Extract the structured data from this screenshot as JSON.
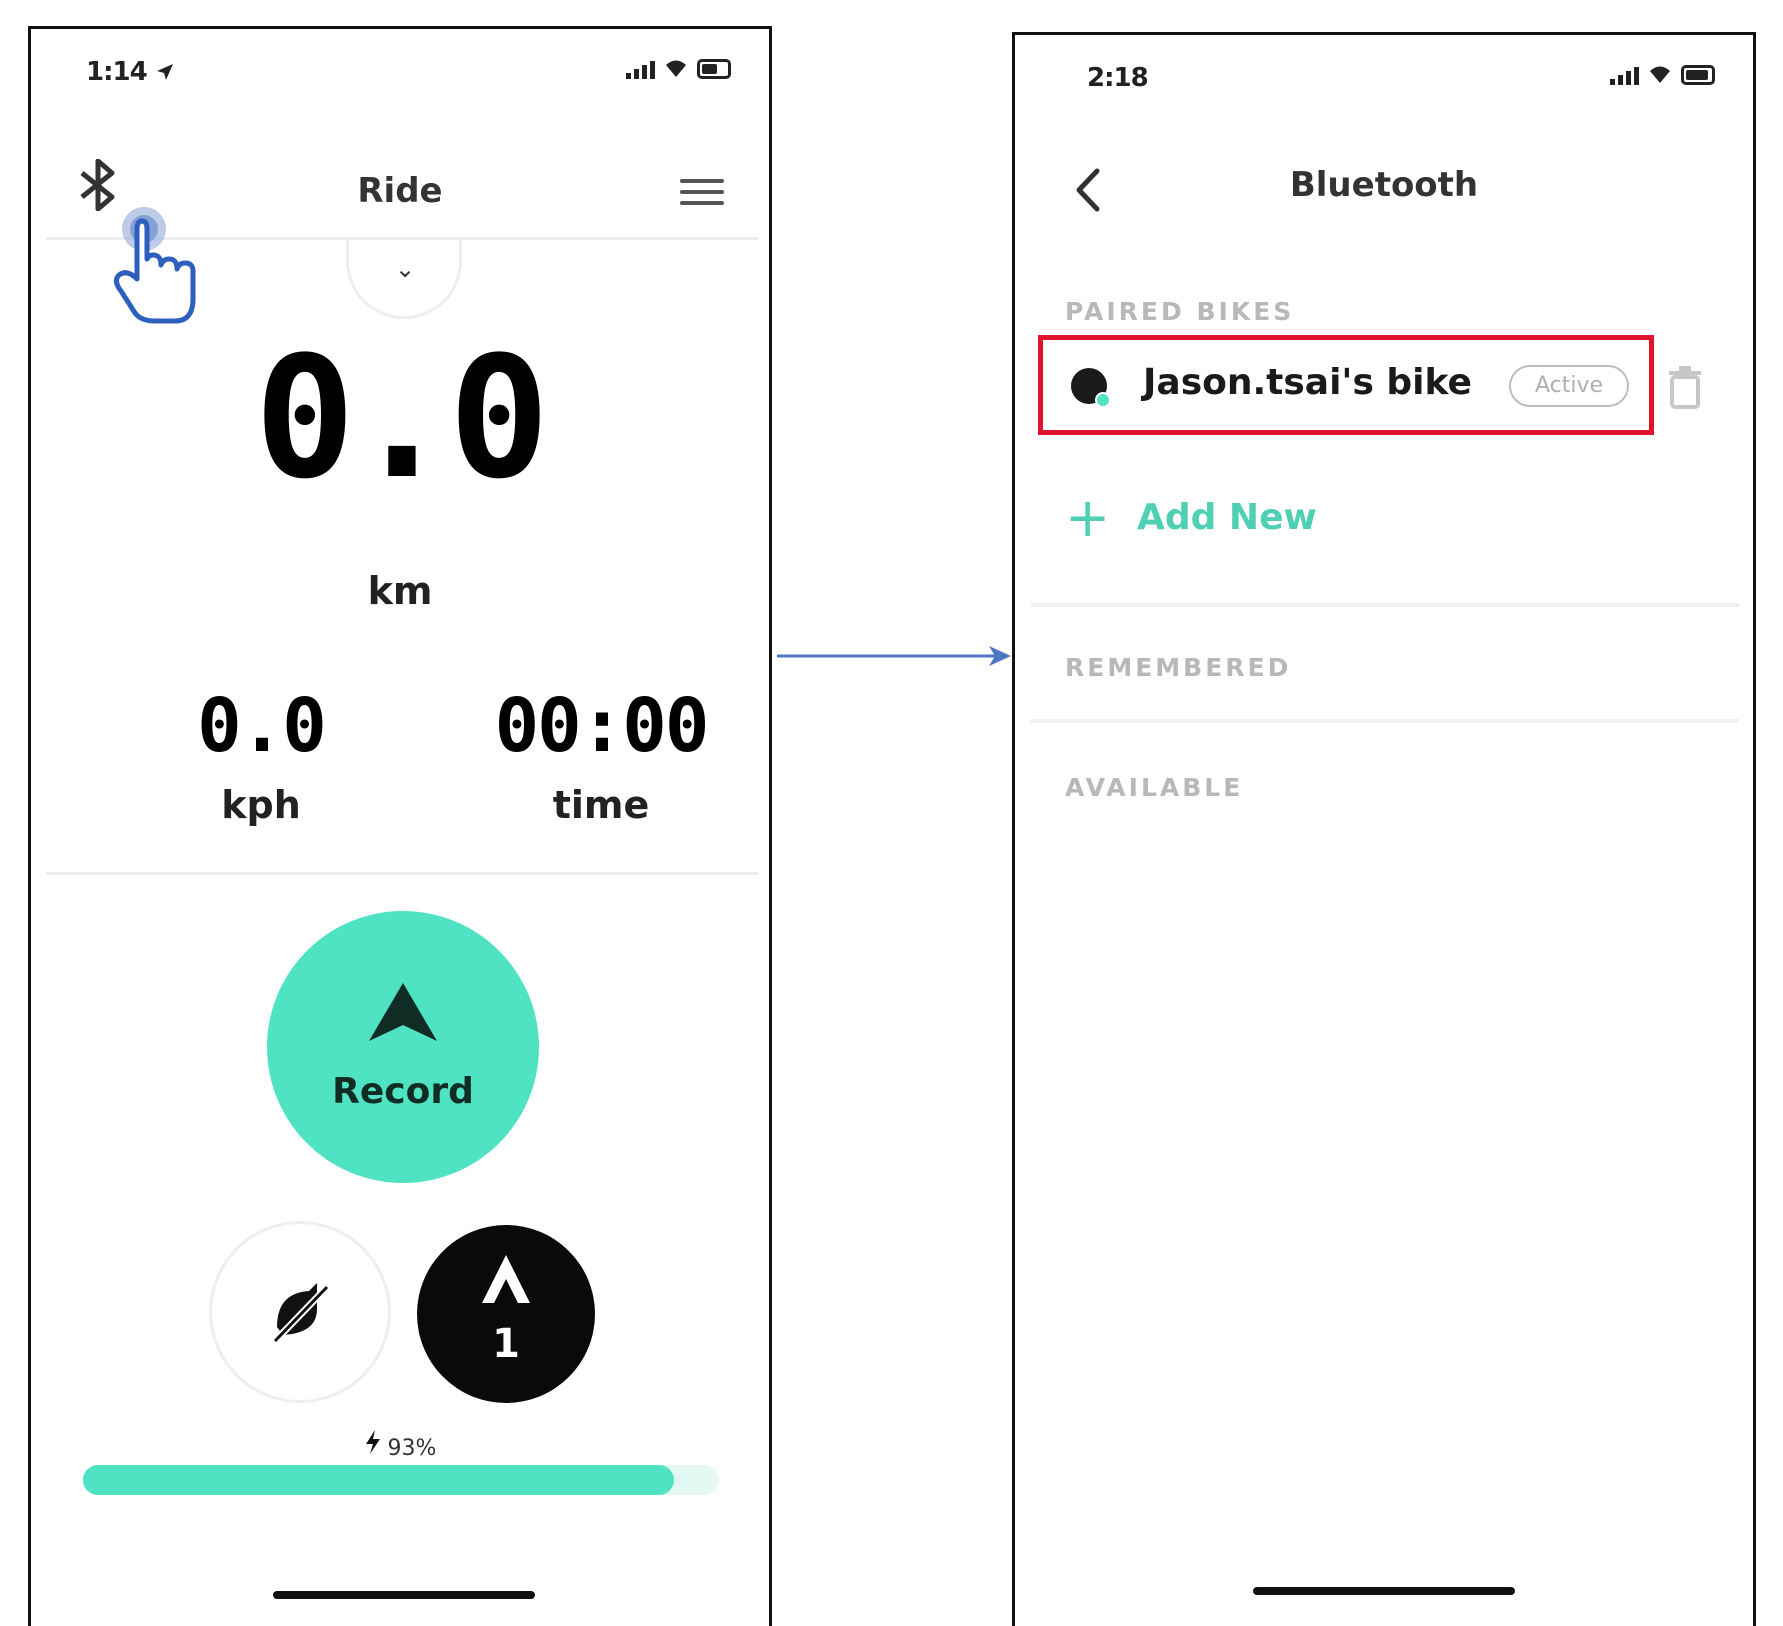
{
  "left_screen": {
    "status_time": "1:14",
    "header_title": "Ride",
    "distance_value": "0.0",
    "distance_unit": "km",
    "speed_value": "0.0",
    "speed_unit": "kph",
    "time_value": "00:00",
    "time_unit": "time",
    "record_label": "Record",
    "assist_level": "1",
    "battery_text": "93%",
    "battery_fraction": 0.93,
    "accent_color": "#4fe3c4"
  },
  "right_screen": {
    "status_time": "2:18",
    "header_title": "Bluetooth",
    "paired_section": "PAIRED BIKES",
    "paired_bike_name": "Jason.tsai's bike",
    "paired_bike_status": "Active",
    "add_new_label": "Add New",
    "remembered_section": "REMEMBERED",
    "available_section": "AVAILABLE",
    "highlight_color": "#e0132a"
  },
  "icons": [
    "location-arrow-icon",
    "signal-icon",
    "wifi-icon",
    "battery-icon",
    "bluetooth-icon",
    "menu-icon",
    "tap-hand-icon",
    "chevron-down-icon",
    "navigation-arrow-icon",
    "assist-off-icon",
    "assist-icon",
    "bolt-icon",
    "back-chevron-icon",
    "trash-icon",
    "plus-icon",
    "flow-arrow"
  ]
}
